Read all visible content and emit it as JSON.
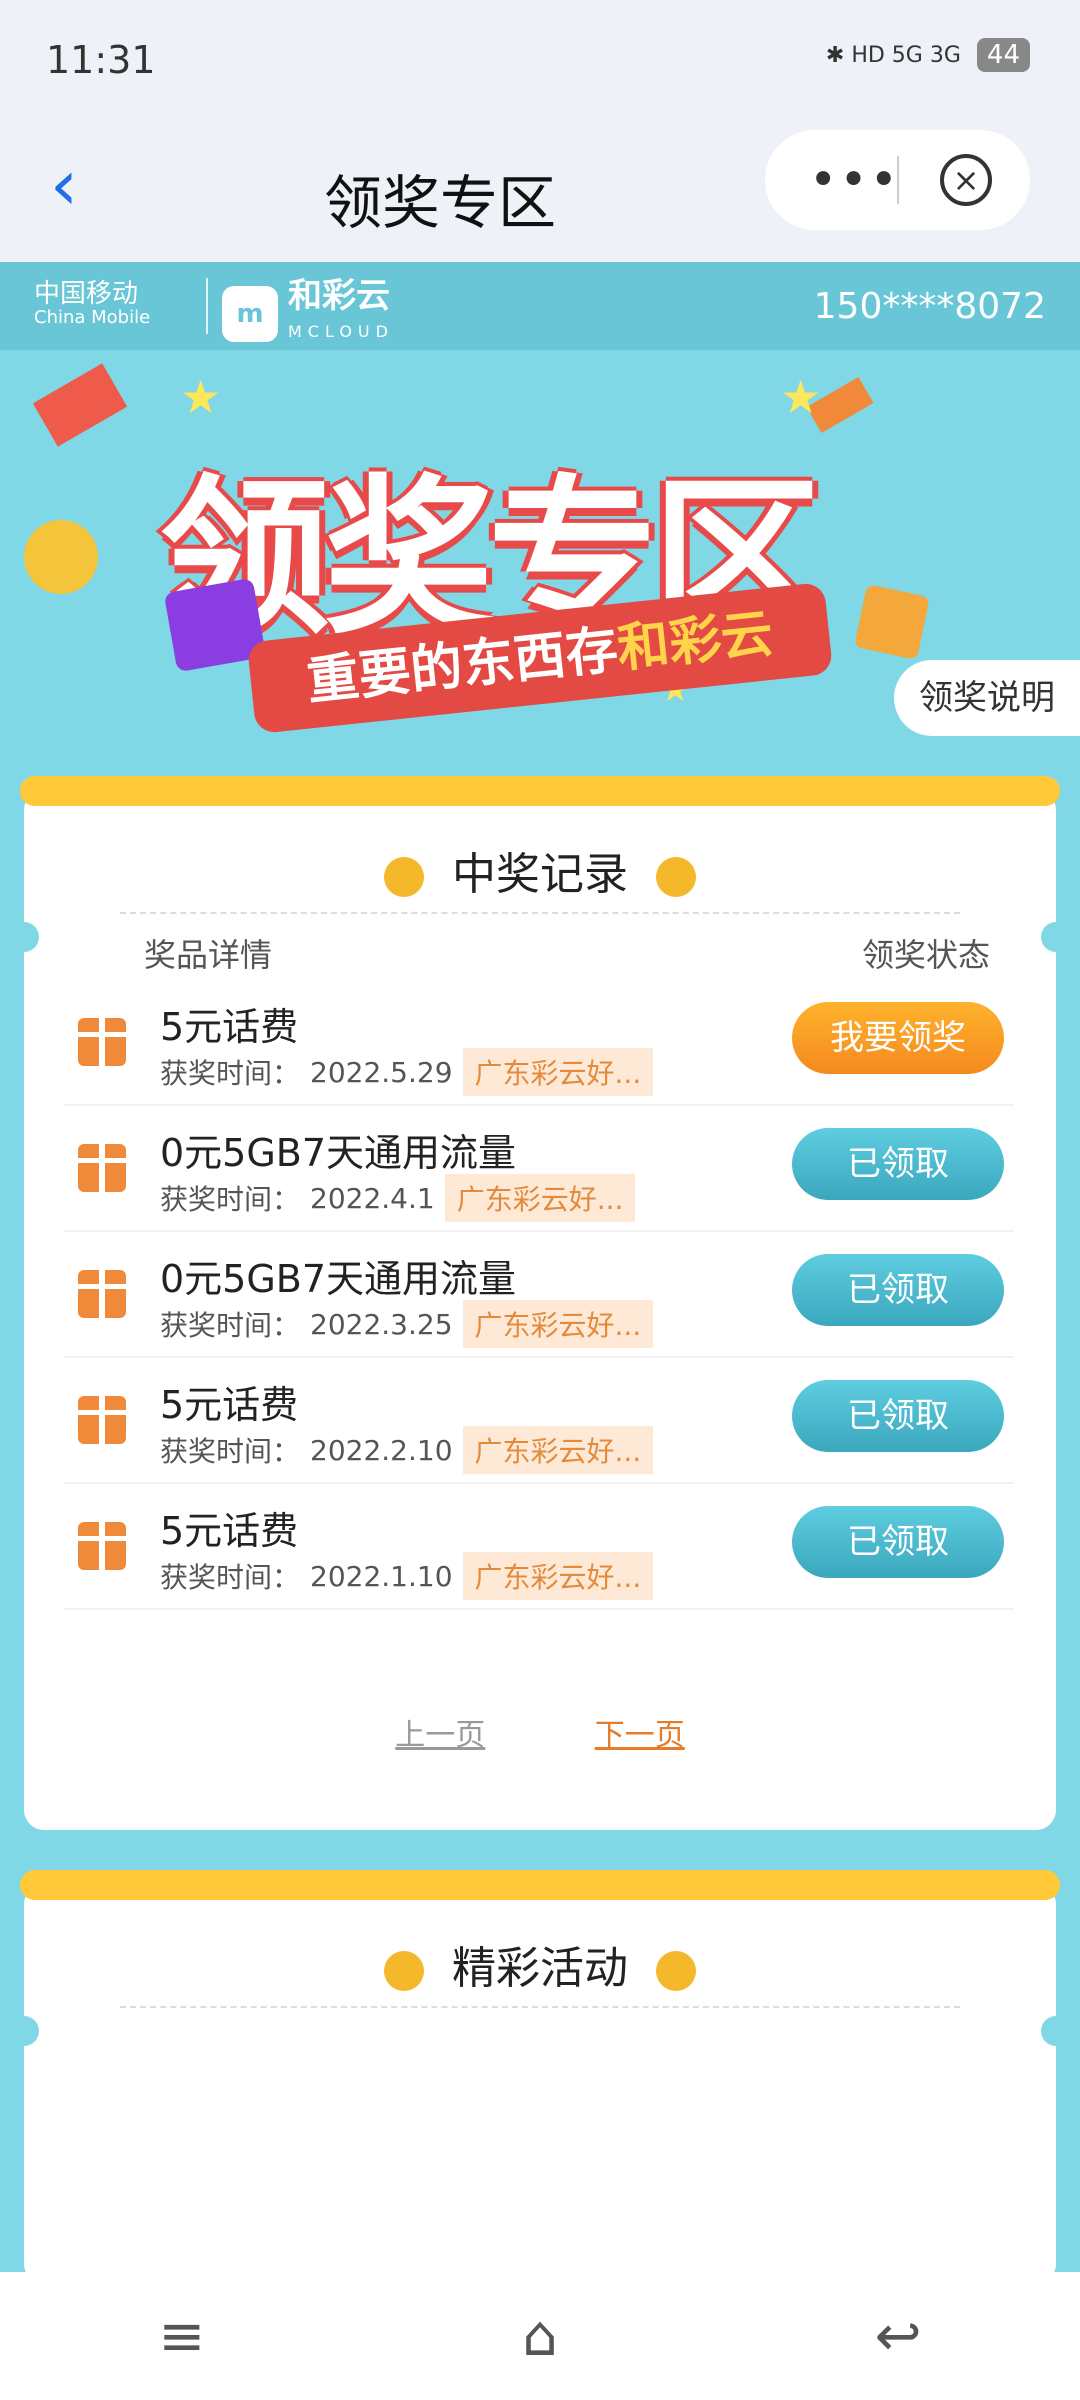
{
  "status_bar": {
    "time": "11:31",
    "icons_text": "✱ HD 5G 3G",
    "battery": "44"
  },
  "nav": {
    "title": "领奖专区",
    "back_icon": "‹",
    "more_icon": "•••",
    "close_icon": "×"
  },
  "brand": {
    "logo1_cn": "中国移动",
    "logo1_en": "China Mobile",
    "logo2_cn": "和彩云",
    "logo2_en": "MCLOUD",
    "phone": "150****8072"
  },
  "banner": {
    "title": "领奖专区",
    "ribbon_prefix": "重要的东西存",
    "ribbon_highlight": "和彩云",
    "rules_button": "领奖说明"
  },
  "records": {
    "title": "中奖记录",
    "col_details": "奖品详情",
    "col_status": "领奖状态",
    "time_prefix": "获奖时间：",
    "rows": [
      {
        "name": "5元话费",
        "time": "2022.5.29",
        "source": "广东彩云好...",
        "status": "我要领奖"
      },
      {
        "name": "0元5GB7天通用流量",
        "time": "2022.4.1",
        "source": "广东彩云好...",
        "status": "已领取"
      },
      {
        "name": "0元5GB7天通用流量",
        "time": "2022.3.25",
        "source": "广东彩云好...",
        "status": "已领取"
      },
      {
        "name": "5元话费",
        "time": "2022.2.10",
        "source": "广东彩云好...",
        "status": "已领取"
      },
      {
        "name": "5元话费",
        "time": "2022.1.10",
        "source": "广东彩云好...",
        "status": "已领取"
      }
    ],
    "prev": "上一页",
    "next": "下一页"
  },
  "activities": {
    "title": "精彩活动"
  },
  "bottom_nav": {
    "menu_icon": "≡",
    "home_icon": "⌂",
    "back_icon": "↩"
  },
  "colors": {
    "accent_orange": "#f48a1f",
    "accent_teal": "#3aa7bd",
    "bg": "#80d7e6"
  }
}
